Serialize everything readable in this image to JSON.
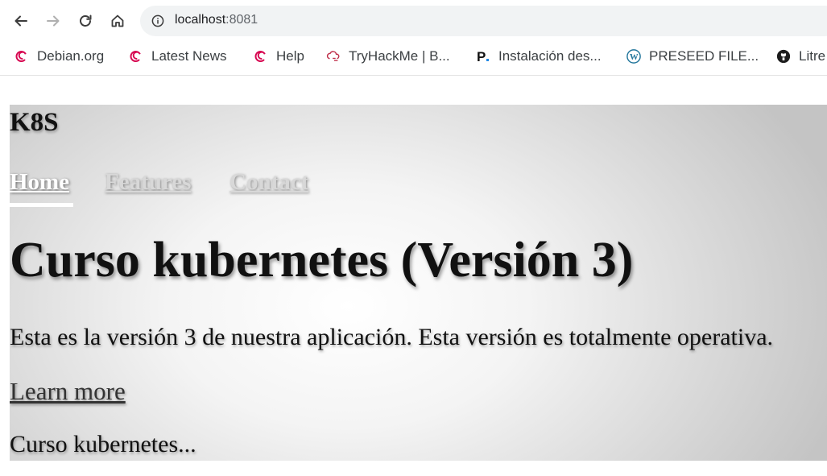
{
  "browser": {
    "url_host": "localhost",
    "url_port": ":8081",
    "bookmarks": [
      {
        "label": "Debian.org",
        "icon": "debian-icon"
      },
      {
        "label": "Latest News",
        "icon": "debian-icon"
      },
      {
        "label": "Help",
        "icon": "debian-icon"
      },
      {
        "label": "TryHackMe | B...",
        "icon": "tryhackme-icon"
      },
      {
        "label": "Instalación des...",
        "icon": "p-logo-icon"
      },
      {
        "label": "PRESEED FILE...",
        "icon": "wordpress-icon"
      },
      {
        "label": "Litre",
        "icon": "github-icon"
      }
    ]
  },
  "page": {
    "brand": "K8S",
    "nav": {
      "home": "Home",
      "features": "Features",
      "contact": "Contact"
    },
    "headline": "Curso kubernetes (Versión 3)",
    "lead": "Esta es la versión 3 de nuestra aplicación. Esta versión es totalmente operativa.",
    "cta": "Learn more",
    "footer": "Curso kubernetes..."
  },
  "colors": {
    "nav_active": "#ffffff",
    "nav_inactive": "#d8d8d8",
    "text": "#111111",
    "debian_red": "#d70751",
    "wordpress_blue": "#21759b"
  }
}
